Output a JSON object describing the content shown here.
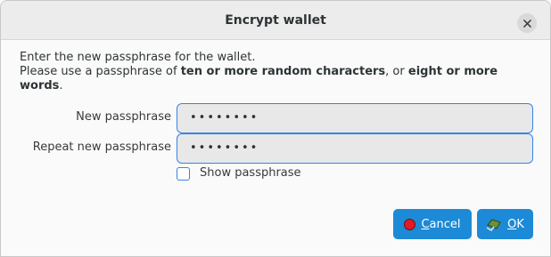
{
  "window": {
    "title": "Encrypt wallet"
  },
  "intro": {
    "line1": "Enter the new passphrase for the wallet.",
    "line2_prefix": "Please use a passphrase of ",
    "line2_bold1": "ten or more random characters",
    "line2_mid": ", or ",
    "line2_bold2": "eight or more words",
    "line2_suffix": "."
  },
  "fields": {
    "new_label": "New passphrase",
    "new_value": "••••••••",
    "repeat_label": "Repeat new passphrase",
    "repeat_value": "••••••••"
  },
  "show_passphrase": {
    "label": "Show passphrase",
    "checked": false
  },
  "buttons": {
    "cancel_mnemonic": "C",
    "cancel_rest": "ancel",
    "ok_mnemonic": "O",
    "ok_rest": "K"
  },
  "colors": {
    "accent": "#1c8ad6",
    "focus_border": "#3584e4"
  },
  "icons": {
    "close": "close-icon",
    "cancel": "red-circle-icon",
    "ok": "ok-check-icon"
  }
}
